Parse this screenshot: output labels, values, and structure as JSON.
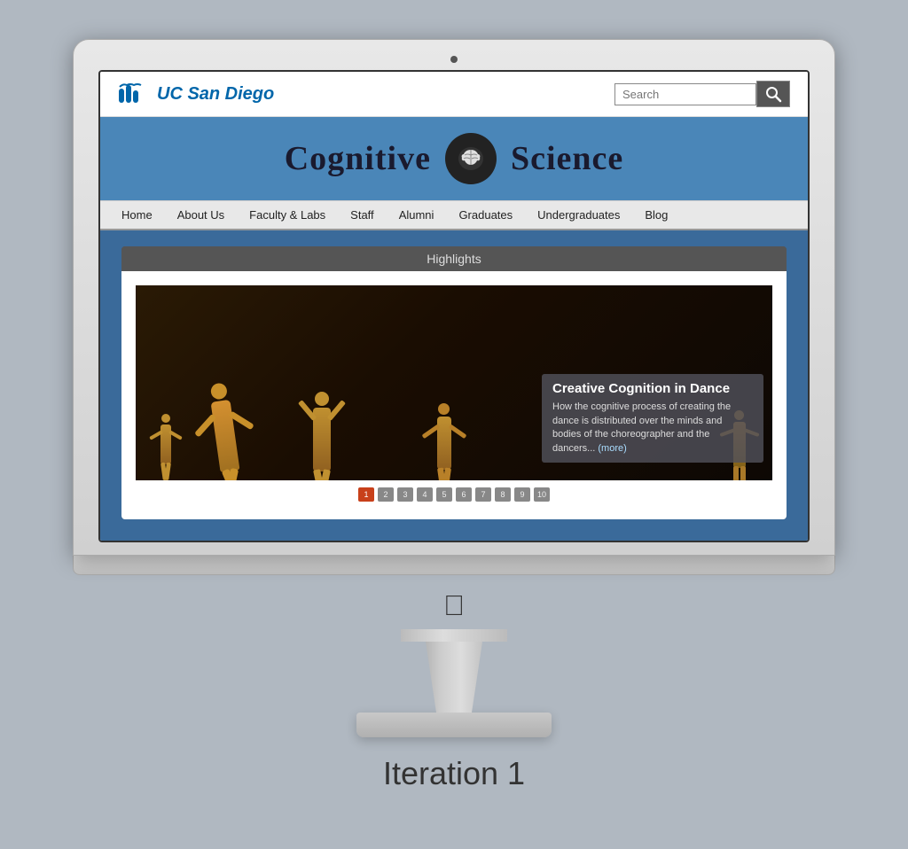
{
  "page": {
    "title": "Iteration 1",
    "bg_color": "#b0b8c1"
  },
  "ucsd": {
    "logo_text": "UC San Diego",
    "search_placeholder": "Search",
    "search_label": "Search"
  },
  "site": {
    "banner_title_left": "Cognitive",
    "banner_title_right": "Science",
    "nav_items": [
      {
        "label": "Home",
        "id": "home"
      },
      {
        "label": "About Us",
        "id": "about"
      },
      {
        "label": "Faculty & Labs",
        "id": "faculty"
      },
      {
        "label": "Staff",
        "id": "staff"
      },
      {
        "label": "Alumni",
        "id": "alumni"
      },
      {
        "label": "Graduates",
        "id": "graduates"
      },
      {
        "label": "Undergraduates",
        "id": "undergrads"
      },
      {
        "label": "Blog",
        "id": "blog"
      }
    ],
    "highlights_label": "Highlights",
    "slide": {
      "title": "Creative Cognition in Dance",
      "description": "How the cognitive process of creating the dance is distributed over the minds and bodies of the choreographer and the dancers...",
      "more_label": "(more)"
    },
    "pagination": [
      "1",
      "2",
      "3",
      "4",
      "5",
      "6",
      "7",
      "8",
      "9",
      "10"
    ],
    "active_page": 0
  }
}
